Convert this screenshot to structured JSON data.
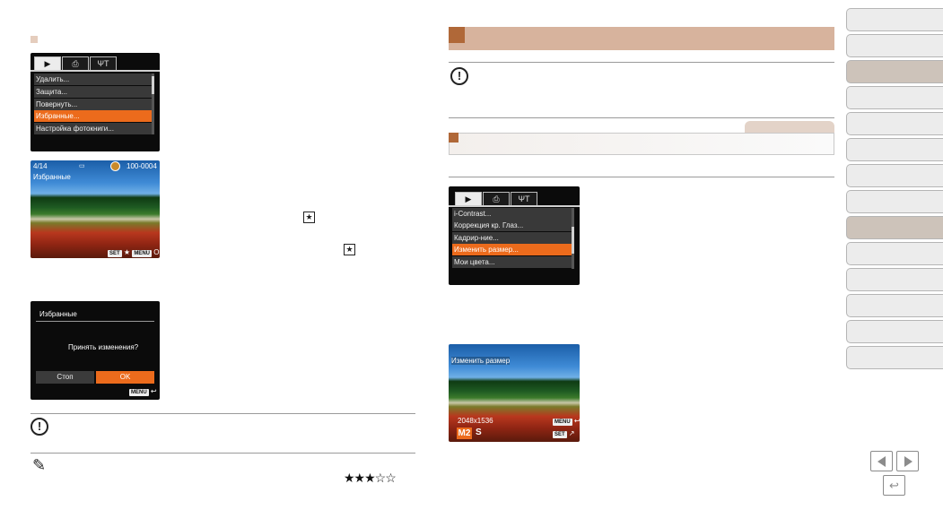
{
  "menu1": {
    "tabs": [
      "▶",
      "⎙",
      "ΨT"
    ],
    "items": [
      "Удалить...",
      "Защита...",
      "Повернуть...",
      "Избранные...",
      "Настройка фотокниги..."
    ],
    "selected_index": 3
  },
  "photo1": {
    "counter": "4/14",
    "file_no": "100-0004",
    "label": "Избранные",
    "set_key": "SET",
    "star": "★",
    "menu_key": "MENU",
    "ok": "OK"
  },
  "star_box": "★",
  "dialog": {
    "title": "Избранные",
    "question": "Принять изменения?",
    "stop": "Стоп",
    "ok": "OK",
    "menu_key": "MENU",
    "back": "↩"
  },
  "rating": "★★★☆☆",
  "menu2": {
    "tabs": [
      "▶",
      "⎙",
      "ΨT"
    ],
    "items": [
      "i-Contrast...",
      "Коррекция кр. Глаз...",
      "Кадрир-ние...",
      "Изменить размер...",
      "Мои цвета..."
    ],
    "selected_index": 3
  },
  "photo2": {
    "label": "Изменить размер",
    "resolution": "2048x1536",
    "size_m2": "M2",
    "size_s": "S",
    "menu_key": "MENU",
    "set_key": "SET",
    "back": "↩",
    "edit": "↗"
  },
  "nav": {
    "sections": 14,
    "highlighted": [
      2,
      8
    ],
    "prev": "◀",
    "next": "▶",
    "back": "↩"
  },
  "colors": {
    "accent": "#d7b39d",
    "highlight": "#ec6b1c"
  }
}
